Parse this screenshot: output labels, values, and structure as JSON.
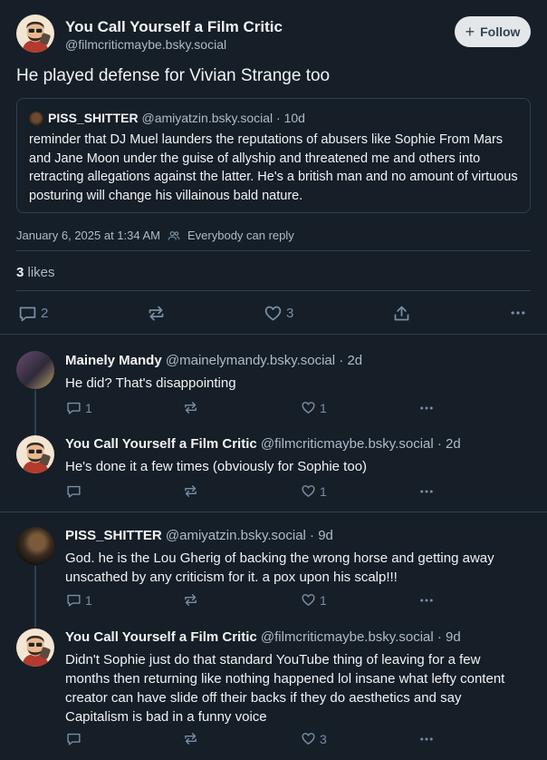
{
  "main_post": {
    "display_name": "You Call Yourself a Film Critic",
    "handle": "@filmcriticmaybe.bsky.social",
    "follow_label": "Follow",
    "text": "He played defense for Vivian Strange too",
    "quote": {
      "display_name": "PISS_SHITTER",
      "handle": "@amiyatzin.bsky.social",
      "age": "· 10d",
      "text": "reminder that DJ Muel launders the reputations of abusers like Sophie From Mars and Jane Moon under the guise of allyship and threatened me and others into retracting allegations against the latter. He's a british man and no amount of virtuous posturing will change his villainous bald nature."
    },
    "timestamp": "January 6, 2025 at 1:34 AM",
    "reply_setting": "Everybody can reply",
    "likes_count": "3",
    "likes_label": "likes",
    "actions": {
      "replies": "2",
      "likes": "3"
    }
  },
  "replies": [
    {
      "display_name": "Mainely Mandy",
      "handle": "@mainelymandy.bsky.social",
      "age": "· 2d",
      "text": "He did? That's disappointing",
      "reply_count": "1",
      "like_count": "1"
    },
    {
      "display_name": "You Call Yourself a Film Critic",
      "handle": "@filmcriticmaybe.bsky.social",
      "age": "· 2d",
      "text": "He's done it a few times (obviously for Sophie too)",
      "reply_count": "",
      "like_count": "1"
    },
    {
      "display_name": "PISS_SHITTER",
      "handle": "@amiyatzin.bsky.social",
      "age": "· 9d",
      "text": "God. he is the Lou Gherig of backing the wrong horse and getting away unscathed by any criticism for it. a pox upon his scalp!!!",
      "reply_count": "1",
      "like_count": "1"
    },
    {
      "display_name": "You Call Yourself a Film Critic",
      "handle": "@filmcriticmaybe.bsky.social",
      "age": "· 9d",
      "text": "Didn't Sophie just do that standard YouTube thing of leaving for a few months then returning like nothing happened lol insane what lefty content creator can have slide off their backs if they do aesthetics and say Capitalism is bad in a funny voice",
      "reply_count": "",
      "like_count": "3"
    }
  ],
  "icons": {
    "reply": "speech-bubble-icon",
    "repost": "repost-arrows-icon",
    "like": "heart-icon",
    "share": "share-upload-icon",
    "more": "ellipsis-icon",
    "everybody": "people-icon",
    "plus": "plus-icon"
  },
  "colors": {
    "background": "#161e27",
    "separator": "#2e4052",
    "follow_bg": "#e3e7ea",
    "muted": "#aebbc9"
  }
}
